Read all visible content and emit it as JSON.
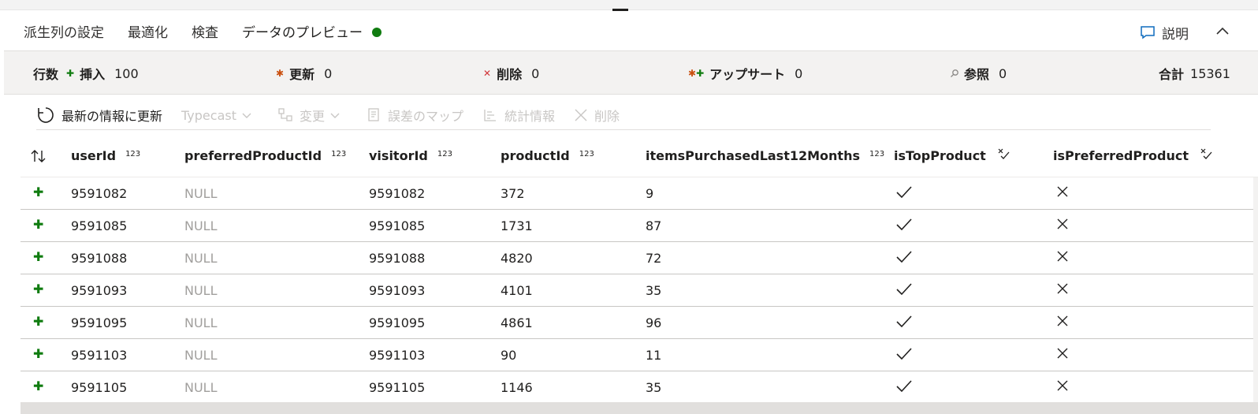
{
  "tabs": [
    {
      "label": "派生列の設定"
    },
    {
      "label": "最適化"
    },
    {
      "label": "検査"
    },
    {
      "label": "データのプレビュー"
    }
  ],
  "help": {
    "label": "説明"
  },
  "stats": {
    "rows_label": "行数",
    "insert": {
      "label": "挿入",
      "value": "100"
    },
    "update": {
      "label": "更新",
      "value": "0"
    },
    "delete": {
      "label": "削除",
      "value": "0"
    },
    "upsert": {
      "label": "アップサート",
      "value": "0"
    },
    "lookup": {
      "label": "参照",
      "value": "0"
    },
    "total": {
      "label": "合計",
      "value": "15361"
    }
  },
  "toolbar": {
    "refresh": "最新の情報に更新",
    "typecast": "Typecast",
    "modify": "変更",
    "error_map": "誤差のマップ",
    "statistics": "統計情報",
    "remove": "削除"
  },
  "columns": [
    {
      "name": "userId",
      "badge": "123"
    },
    {
      "name": "preferredProductId",
      "badge": "123"
    },
    {
      "name": "visitorId",
      "badge": "123"
    },
    {
      "name": "productId",
      "badge": "123"
    },
    {
      "name": "itemsPurchasedLast12Months",
      "badge": "123"
    },
    {
      "name": "isTopProduct"
    },
    {
      "name": "isPreferredProduct"
    }
  ],
  "rows": [
    {
      "userId": "9591082",
      "preferredProductId": "NULL",
      "visitorId": "9591082",
      "productId": "372",
      "items": "9"
    },
    {
      "userId": "9591085",
      "preferredProductId": "NULL",
      "visitorId": "9591085",
      "productId": "1731",
      "items": "87"
    },
    {
      "userId": "9591088",
      "preferredProductId": "NULL",
      "visitorId": "9591088",
      "productId": "4820",
      "items": "72"
    },
    {
      "userId": "9591093",
      "preferredProductId": "NULL",
      "visitorId": "9591093",
      "productId": "4101",
      "items": "35"
    },
    {
      "userId": "9591095",
      "preferredProductId": "NULL",
      "visitorId": "9591095",
      "productId": "4861",
      "items": "96"
    },
    {
      "userId": "9591103",
      "preferredProductId": "NULL",
      "visitorId": "9591103",
      "productId": "90",
      "items": "11"
    },
    {
      "userId": "9591105",
      "preferredProductId": "NULL",
      "visitorId": "9591105",
      "productId": "1146",
      "items": "35"
    }
  ],
  "colors": {
    "accent": "#0f6cbd",
    "insert_green": "#107c10",
    "delete_red": "#d13438",
    "update_orange": "#ca5010"
  },
  "icons": {
    "insert": "plus-icon",
    "update": "asterisk-icon",
    "delete": "x-icon",
    "upsert": "upsert-icon",
    "lookup": "search-icon",
    "true": "check-icon",
    "false": "cross-icon"
  }
}
